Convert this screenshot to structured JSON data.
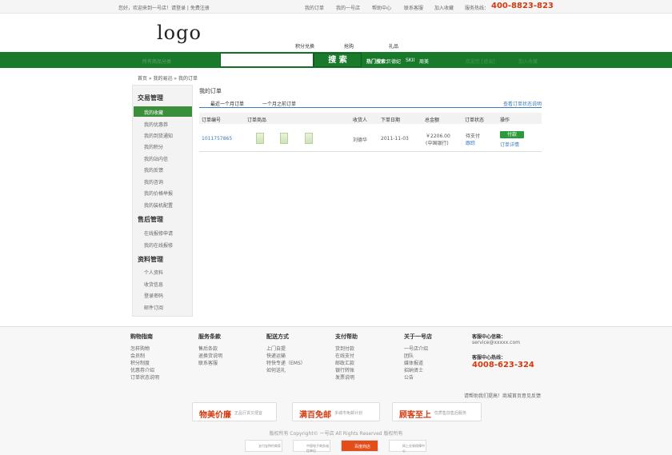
{
  "topbar": {
    "welcome": "您好，欢迎来到一号店！请登录 | 免费注册",
    "links": [
      "我的订单",
      "我的一号店",
      "帮助中心",
      "联系客服",
      "加入收藏"
    ],
    "hotline_label": "服务热线：",
    "hotline": "400-8823-823"
  },
  "logo": "logo",
  "main_nav": [
    "积分兑换",
    "抢购",
    "礼品"
  ],
  "search": {
    "all_categories": "所有商品分类",
    "button": "搜 索",
    "hot_label": "热门搜索：",
    "hot_words": [
      "贝德妃",
      "SKII",
      "周美"
    ],
    "welcome": "欢迎您  [退出]",
    "favorite": "加入收藏"
  },
  "breadcrumb": "首页 » 我的易迅 » 我的订单",
  "sidebar": {
    "sections": [
      {
        "title": "交易管理",
        "items": [
          "我的收藏",
          "我的优惠券",
          "我的到货通知",
          "我的积分",
          "我的站内信",
          "我的反馈",
          "我的咨询",
          "我的价格举报",
          "我的装机配置"
        ]
      },
      {
        "title": "售后管理",
        "items": [
          "在线报修申请",
          "我的在线报修"
        ]
      },
      {
        "title": "资料管理",
        "items": [
          "个人资料",
          "收货信息",
          "登录密码",
          "邮件订阅"
        ]
      }
    ],
    "active": "我的收藏"
  },
  "orders": {
    "title": "我的订单",
    "tabs": [
      "最近一个月订单",
      "一个月之前订单"
    ],
    "status_doc": "查看订单状态说明",
    "columns": [
      "订单编号",
      "订单商品",
      "收货人",
      "下单日期",
      "总金额",
      "订单状态",
      "操作"
    ],
    "rows": [
      {
        "order_no": "1011757865",
        "recipient": "刘德华",
        "date": "2011-11-03",
        "amount": "￥2206.00",
        "payment": "(中国银行)",
        "status": "待支付",
        "track": "跟踪",
        "pay": "付款",
        "detail": "订单详情"
      }
    ]
  },
  "footer": {
    "columns": [
      {
        "title": "购物指南",
        "items": [
          "怎样购物",
          "会员制",
          "积分制度",
          "优惠券介绍",
          "订单状态说明"
        ]
      },
      {
        "title": "服务条款",
        "items": [
          "售后条款",
          "退换货说明",
          "联系客服"
        ]
      },
      {
        "title": "配送方式",
        "items": [
          "上门自提",
          "快递运输",
          "特快专递（EMS）",
          "如何送礼"
        ]
      },
      {
        "title": "支付帮助",
        "items": [
          "货到付款",
          "在线支付",
          "邮政汇款",
          "银行转账",
          "发票说明"
        ]
      },
      {
        "title": "关于一号店",
        "items": [
          "一号店介绍",
          "团队",
          "媒体报道",
          "招纳贤士",
          "公告"
        ]
      }
    ],
    "service": {
      "email_label": "客服中心信箱：",
      "email": "service@xxxxx.com",
      "tel_label": "客服中心热线：",
      "tel": "4008-623-324"
    },
    "suggest": "请帮助我们提高！商城首页意见反馈",
    "badges": [
      {
        "big": "物美价廉",
        "small": "正品行货又便宜"
      },
      {
        "big": "满百免邮",
        "small": "多城市免邮计划"
      },
      {
        "big": "顾客至上",
        "small": "优质售前售后服务"
      }
    ],
    "copyright": "版权所有 Copyright© 一号店 All Rights Reserved 版权所有",
    "certs": [
      "支付宝特约商家",
      "中国电子商务诚信单位",
      "百度商店",
      "网上交易保障中心"
    ]
  }
}
